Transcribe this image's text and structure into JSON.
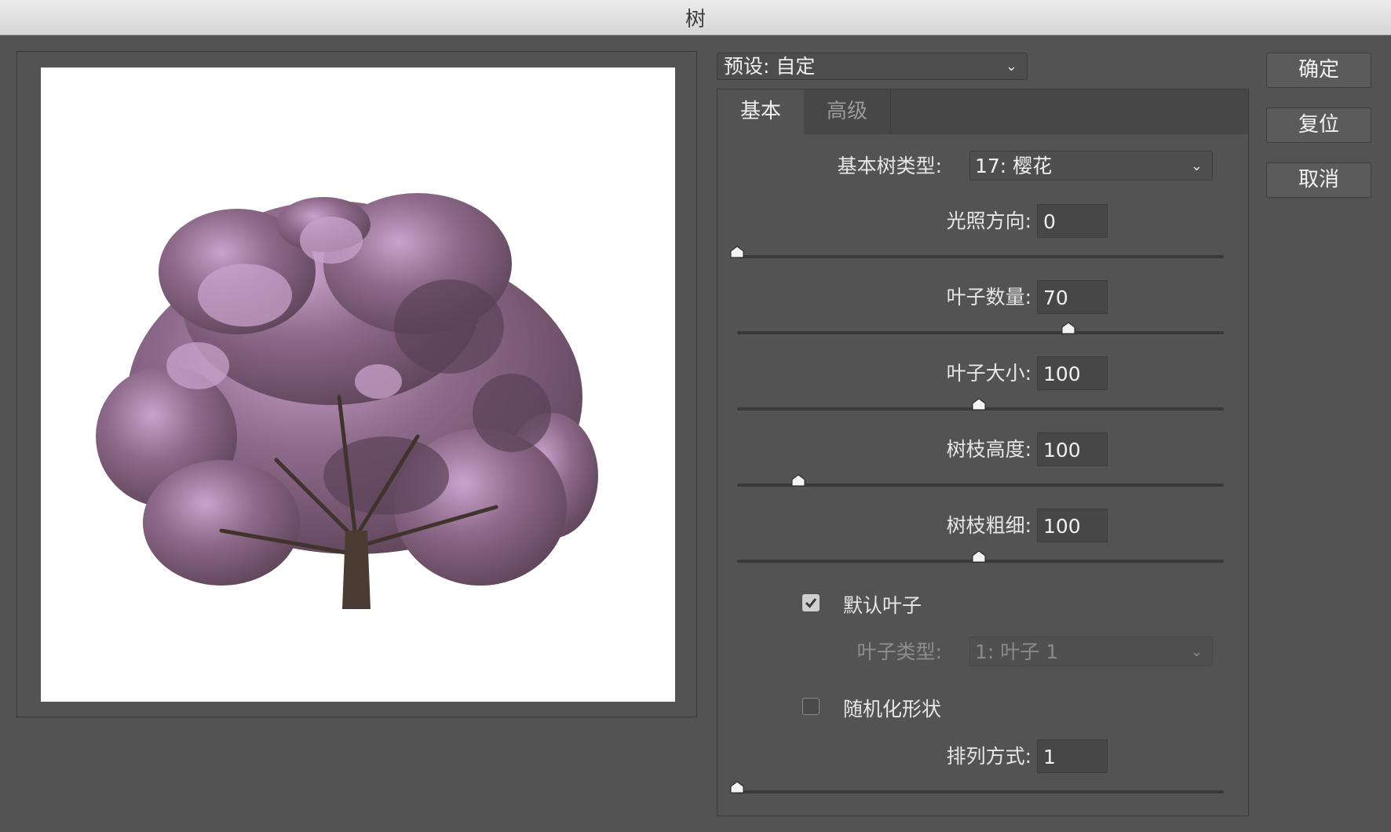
{
  "window": {
    "title": "树"
  },
  "preset": {
    "label": "预设: 自定"
  },
  "buttons": {
    "ok": "确定",
    "reset": "复位",
    "cancel": "取消"
  },
  "tabs": [
    {
      "label": "基本",
      "active": true
    },
    {
      "label": "高级",
      "active": false
    }
  ],
  "tree_type": {
    "label": "基本树类型:",
    "value": "17: 樱花"
  },
  "params": [
    {
      "label": "光照方向:",
      "value": "0",
      "slider_fraction": 0.0
    },
    {
      "label": "叶子数量:",
      "value": "70",
      "slider_fraction": 0.68
    },
    {
      "label": "叶子大小:",
      "value": "100",
      "slider_fraction": 0.497
    },
    {
      "label": "树枝高度:",
      "value": "100",
      "slider_fraction": 0.125
    },
    {
      "label": "树枝粗细:",
      "value": "100",
      "slider_fraction": 0.497
    }
  ],
  "default_leaves": {
    "label": "默认叶子",
    "checked": true
  },
  "leaf_type": {
    "label": "叶子类型:",
    "value": "1: 叶子 1",
    "disabled": true
  },
  "randomize": {
    "label": "随机化形状",
    "checked": false
  },
  "arrangement": {
    "label": "排列方式:",
    "value": "1",
    "slider_fraction": 0.0
  },
  "colors": {
    "foliage": "#7d5878",
    "foliage_light": "#c9a3cc",
    "trunk": "#4a3c33"
  }
}
